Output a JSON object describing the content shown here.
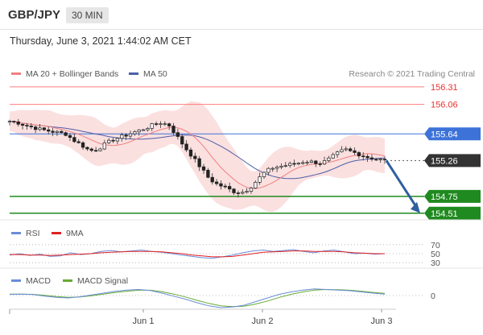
{
  "header": {
    "symbol": "GBP/JPY",
    "timeframe": "30 MIN"
  },
  "timestamp": "Thursday, June 3, 2021 1:44:02 AM CET",
  "legend": {
    "ma20": "MA 20 + Bollinger Bands",
    "ma50": "MA 50",
    "credit": "Research © 2021 Trading Central"
  },
  "colors": {
    "ma20": "#f08080",
    "ma50": "#4b5ea8",
    "resistance": "#ff7b7b",
    "blue_level": "#3d72d8",
    "support": "#1f8a1f",
    "last": "#333333",
    "arrow": "#2f5f9f",
    "rsi": "#6a8cd8",
    "rsi_ma": "#e02020",
    "macd": "#6a8cd8",
    "macd_signal": "#66aa33"
  },
  "chart_data": [
    {
      "type": "candlestick",
      "title": "",
      "ylim": [
        154.45,
        156.4
      ],
      "x_ticks": [
        "Jun 1",
        "Jun 2",
        "Jun 3"
      ],
      "levels": [
        {
          "label": "156.31",
          "value": 156.31,
          "kind": "resistance"
        },
        {
          "label": "156.06",
          "value": 156.06,
          "kind": "resistance"
        },
        {
          "label": "155.64",
          "value": 155.64,
          "kind": "level"
        },
        {
          "label": "155.26",
          "value": 155.26,
          "kind": "last"
        },
        {
          "label": "154.75",
          "value": 154.75,
          "kind": "support"
        },
        {
          "label": "154.51",
          "value": 154.51,
          "kind": "support"
        }
      ],
      "close_path": [
        155.82,
        155.8,
        155.76,
        155.73,
        155.7,
        155.68,
        155.66,
        155.64,
        155.55,
        155.48,
        155.4,
        155.42,
        155.5,
        155.56,
        155.6,
        155.64,
        155.68,
        155.72,
        155.77,
        155.8,
        155.76,
        155.6,
        155.44,
        155.3,
        155.15,
        155.0,
        154.92,
        154.88,
        154.82,
        154.8,
        154.86,
        154.98,
        155.1,
        155.16,
        155.18,
        155.2,
        155.22,
        155.25,
        155.24,
        155.22,
        155.28,
        155.36,
        155.42,
        155.38,
        155.34,
        155.3,
        155.28,
        155.26
      ],
      "projection": {
        "from": 155.26,
        "to": 154.51
      }
    },
    {
      "type": "line",
      "title": "RSI",
      "series": [
        {
          "name": "RSI"
        },
        {
          "name": "9MA"
        }
      ],
      "y_ticks": [
        "70",
        "50",
        "30"
      ],
      "rsi": [
        47,
        50,
        46,
        49,
        44,
        45,
        52,
        48,
        50,
        55,
        57,
        54,
        56,
        58,
        55,
        53,
        50,
        47,
        44,
        41,
        40,
        43,
        47,
        52,
        56,
        58,
        55,
        57,
        59,
        55,
        52,
        56,
        58,
        54,
        50,
        51,
        49,
        50
      ],
      "rsi_ma": [
        48,
        48,
        47,
        47,
        46,
        47,
        48,
        49,
        50,
        52,
        53,
        54,
        55,
        55,
        55,
        54,
        52,
        50,
        47,
        45,
        43,
        43,
        44,
        47,
        50,
        53,
        54,
        55,
        56,
        56,
        55,
        55,
        55,
        54,
        52,
        51,
        50,
        50
      ]
    },
    {
      "type": "line",
      "title": "MACD",
      "series": [
        {
          "name": "MACD"
        },
        {
          "name": "MACD Signal"
        }
      ],
      "y_ticks": [
        "0"
      ],
      "macd": [
        0.1,
        0.12,
        0.08,
        -0.05,
        -0.15,
        -0.2,
        -0.1,
        0.05,
        0.2,
        0.35,
        0.45,
        0.5,
        0.42,
        0.2,
        -0.05,
        -0.3,
        -0.6,
        -0.85,
        -1.0,
        -0.95,
        -0.8,
        -0.5,
        -0.2,
        0.1,
        0.3,
        0.45,
        0.55,
        0.5,
        0.45,
        0.4,
        0.3,
        0.2,
        0.12
      ],
      "signal": [
        0.12,
        0.12,
        0.1,
        0.02,
        -0.08,
        -0.15,
        -0.12,
        -0.02,
        0.12,
        0.25,
        0.36,
        0.44,
        0.44,
        0.32,
        0.12,
        -0.12,
        -0.4,
        -0.65,
        -0.85,
        -0.92,
        -0.88,
        -0.7,
        -0.45,
        -0.15,
        0.1,
        0.3,
        0.45,
        0.5,
        0.48,
        0.44,
        0.36,
        0.26,
        0.17
      ]
    }
  ]
}
